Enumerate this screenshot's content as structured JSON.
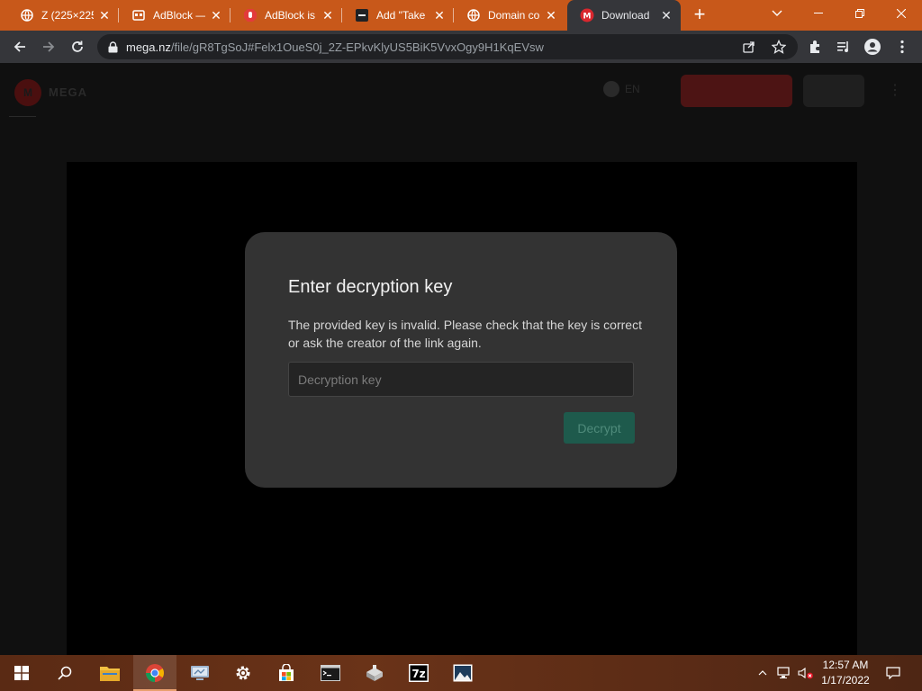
{
  "browser": {
    "tabs": [
      {
        "title": "Z (225×225",
        "favicon": "globe-icon",
        "active": false
      },
      {
        "title": "AdBlock —",
        "favicon": "extension-page-icon",
        "active": false
      },
      {
        "title": "AdBlock is",
        "favicon": "adblock-hand-icon",
        "active": false
      },
      {
        "title": "Add \"Take",
        "favicon": "dark-site-icon",
        "active": false
      },
      {
        "title": "Domain co",
        "favicon": "globe-icon",
        "active": false
      },
      {
        "title": "Download",
        "favicon": "mega-icon",
        "active": true
      }
    ],
    "address": {
      "host": "mega.nz",
      "path": "/file/gR8TgSoJ#Felx1OueS0j_2Z-EPkvKlyUS5BiK5VvxOgy9H1KqEVsw"
    }
  },
  "page": {
    "header": {
      "logo_letter": "M",
      "brand": "MEGA",
      "lang": "EN"
    }
  },
  "modal": {
    "title": "Enter decryption key",
    "message": "The provided key is invalid. Please check that the key is correct or ask the creator of the link again.",
    "input_placeholder": "Decryption key",
    "input_value": "",
    "button_label": "Decrypt"
  },
  "taskbar": {
    "time": "12:57 AM",
    "date": "1/17/2022",
    "apps": [
      "windows-start-icon",
      "search-icon",
      "file-explorer-icon",
      "chrome-icon",
      "remote-desktop-icon",
      "settings-icon",
      "store-icon",
      "terminal-icon",
      "hardware-icon",
      "7zip-icon",
      "photos-icon"
    ]
  },
  "colors": {
    "tabstrip": "#c8581a",
    "toolbar": "#35363a",
    "modal_bg": "#333333",
    "decrypt_button": "#1e5a4c"
  }
}
